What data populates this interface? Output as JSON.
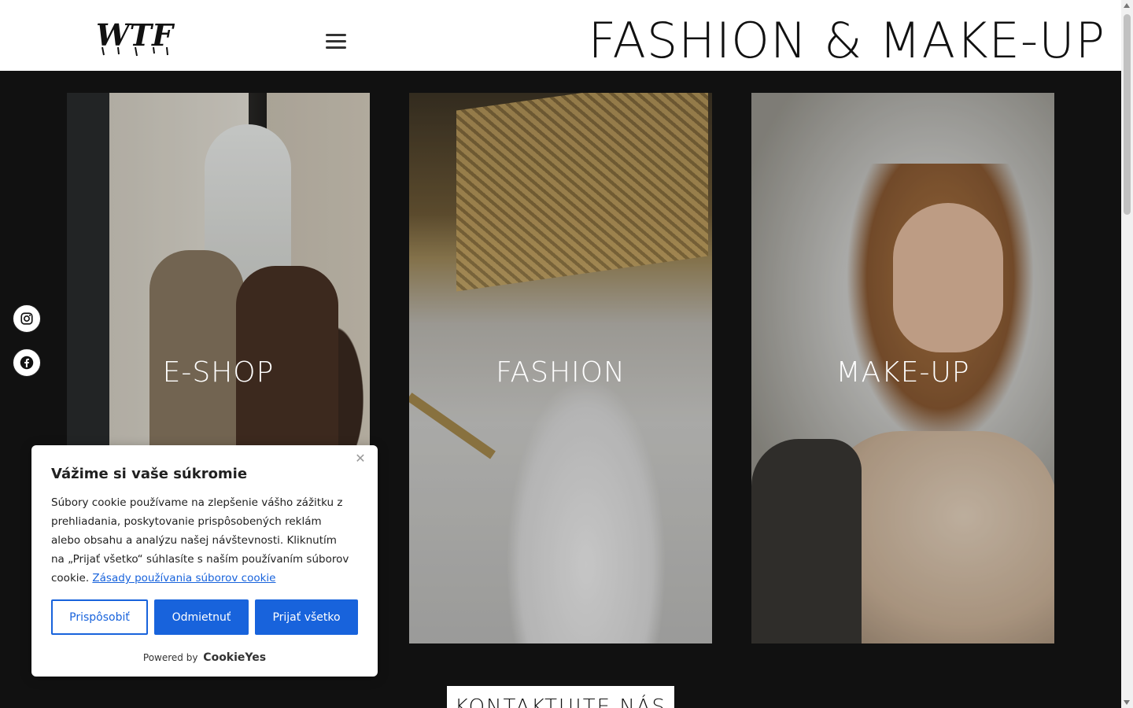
{
  "header": {
    "logo_text": "WTF?!",
    "menu_icon": "hamburger-icon",
    "site_title": "FASHION & MAKE-UP"
  },
  "cards": [
    {
      "label": "E-SHOP"
    },
    {
      "label": "FASHION"
    },
    {
      "label": "MAKE-UP"
    }
  ],
  "social": {
    "instagram_icon": "instagram-icon",
    "facebook_icon": "facebook-icon"
  },
  "contact_button": "KONTAKTUJTE NÁS",
  "cookie_banner": {
    "title": "Vážime si vaše súkromie",
    "description": "Súbory cookie používame na zlepšenie vášho zážitku z prehliadania, poskytovanie prispôsobených reklám alebo obsahu a analýzu našej návštevnosti. Kliknutím na „Prijať všetko“ súhlasíte s naším používaním súborov cookie.",
    "policy_link": "Zásady používania súborov cookie",
    "customize_label": "Prispôsobiť",
    "reject_label": "Odmietnuť",
    "accept_label": "Prijať všetko",
    "powered_by": "Powered by",
    "brand": "CookieYes",
    "accent_color": "#1863dc"
  }
}
